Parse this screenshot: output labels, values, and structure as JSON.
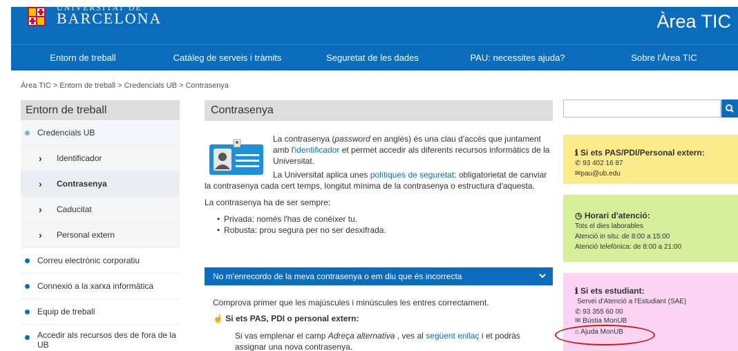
{
  "header": {
    "logo_top": "UNIVERSITAT DE",
    "logo_text": "BARCELONA",
    "area_title": "Àrea TIC"
  },
  "nav": {
    "items": [
      "Entorn de treball",
      "Catàleg de serveis i tràmits",
      "Seguretat de les dades",
      "PAU: necessites ajuda?",
      "Sobre l'Àrea TIC"
    ]
  },
  "breadcrumb": "Àrea TIC > Entorn de treball > Credencials UB > Contrasenya",
  "sidebar": {
    "title": "Entorn de treball",
    "items": [
      {
        "label": "Credencials UB"
      },
      {
        "label": "Identificador"
      },
      {
        "label": "Contrasenya"
      },
      {
        "label": "Caducitat"
      },
      {
        "label": "Personal extern"
      },
      {
        "label": "Correu electrònic corporatiu"
      },
      {
        "label": "Connexió a la xarxa informàtica"
      },
      {
        "label": "Equip de treball"
      },
      {
        "label": "Accedir als recursos des de fora de la UB"
      }
    ]
  },
  "main": {
    "title": "Contrasenya",
    "intro_1": "La contrasenya (",
    "intro_em": "password",
    "intro_2": " en anglès) és una clau d'accés que juntament amb l'",
    "intro_link": "identificador",
    "intro_3": " et permet accedir als diferents recursos informàtics de la Universitat.",
    "p2_1": "La Universitat aplica unes ",
    "p2_link": "polítiques de seguretat",
    "p2_2": ": obligatorietat de canviar la contrasenya cada cert temps, longitut mínima de la contrasenya o estructura d'aquesta.",
    "p3": "La contrasenya ha de ser sempre:",
    "bullets": [
      "Privada: només l'has de conéixer tu.",
      "Robusta: prou segura per no ser desxifrada."
    ],
    "accordion_label": "No m'enrecordo de la meva contrasenya o em diu que és incorrecta",
    "acc_p1": "Comprova primer que les majúscules i minúscules les entres correctament.",
    "acc_heading": "Si ets PAS, PDI o personal extern:",
    "acc_p2_1": "Si vas emplenar el camp ",
    "acc_p2_em": "Adreça alternativa",
    "acc_p2_2": " , ves al ",
    "acc_p2_link": "següent enllaç",
    "acc_p2_3": " i et  podràs",
    "acc_p2_4": "assignar una nova contrasenya."
  },
  "search": {
    "placeholder": ""
  },
  "boxes": {
    "pas": {
      "title": "Si ets PAS/PDI/Personal extern:",
      "phone": "93 402 16 87",
      "email": "pau@ub.edu"
    },
    "horari": {
      "title": "Horari d'atenció:",
      "lines": [
        "Tots el dies laborables",
        "Atenció in situ: de 8:00 a 15:00",
        "Atenció telefònica: de 8:00 a 21:00"
      ]
    },
    "estudiant": {
      "title": "Si ets estudiant:",
      "service": "Servei d'Atenció a l'Estudiant (SAE)",
      "phone": "93 355 60 00",
      "bustia": "Bústia MonUB",
      "ajuda": "Ajuda MonUB"
    }
  },
  "colors": {
    "brand_blue": "#0a6cba",
    "yellow": "#fbeb8b",
    "green": "#d6ee9b",
    "pink": "#fbd5f3",
    "annotation_red": "#c61a1a"
  }
}
